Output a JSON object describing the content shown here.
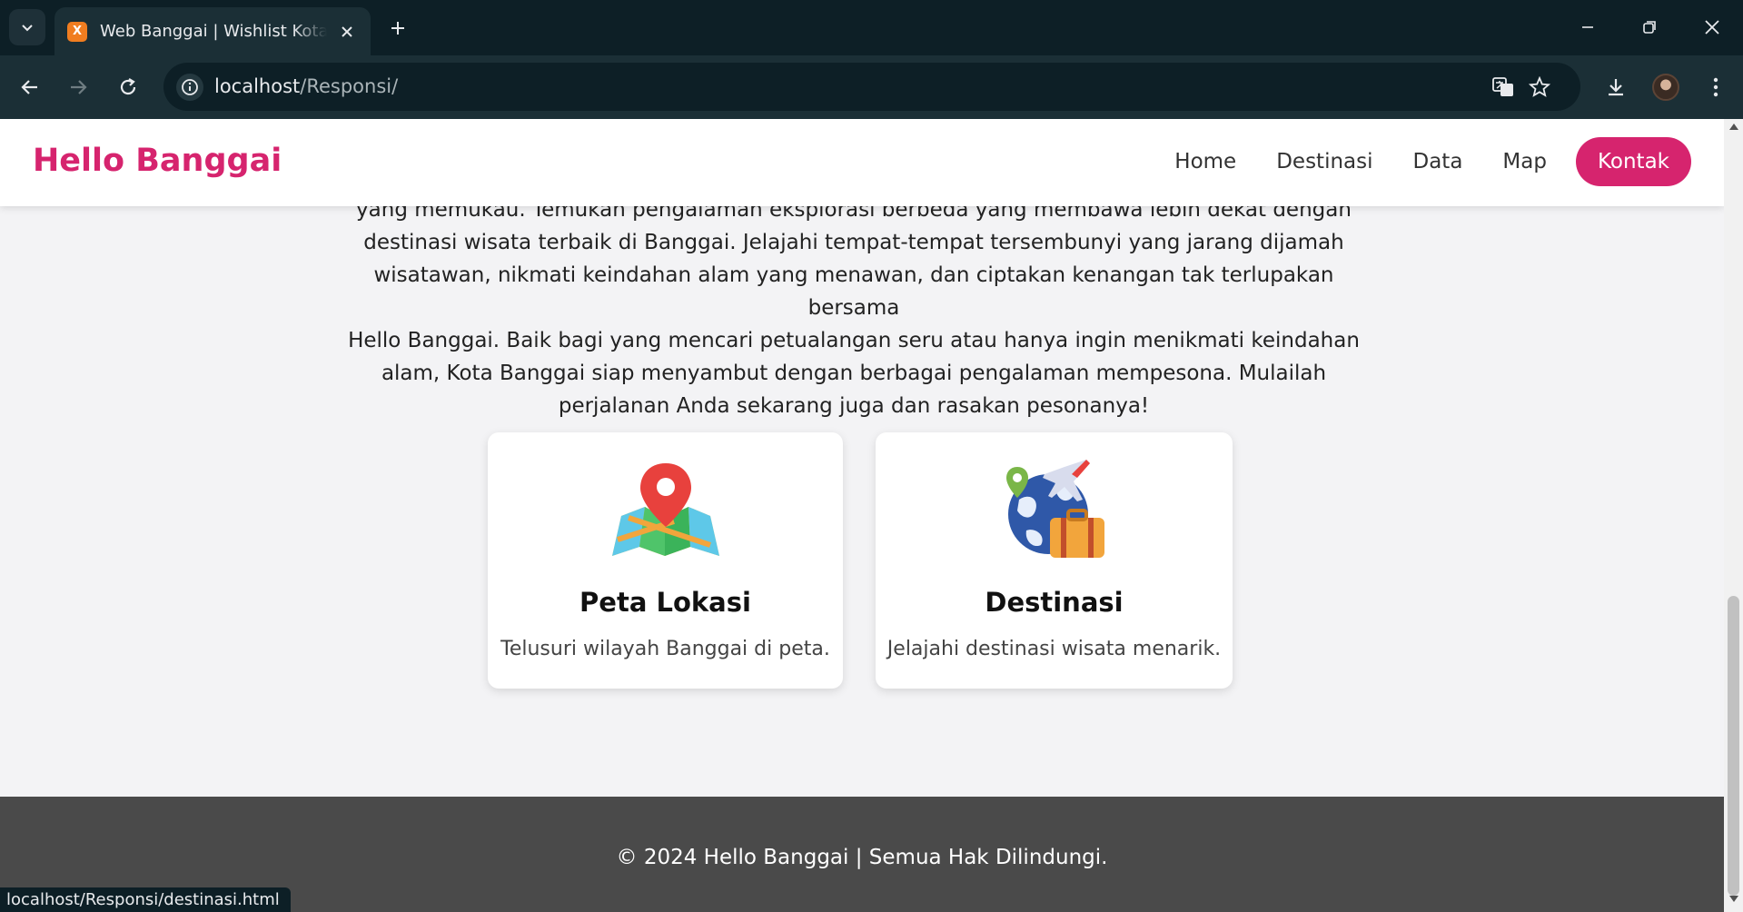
{
  "browser": {
    "tab_title": "Web Banggai | Wishlist Kota Am",
    "favicon_letter": "X",
    "url_host": "localhost",
    "url_path": "/Responsi/",
    "status_url": "localhost/Responsi/destinasi.html"
  },
  "site": {
    "brand": "Hello Banggai",
    "nav": [
      {
        "label": "Home"
      },
      {
        "label": "Destinasi"
      },
      {
        "label": "Data"
      },
      {
        "label": "Map"
      },
      {
        "label": "Kontak"
      }
    ],
    "intro_lines": [
      "yang memukau. Temukan pengalaman eksplorasi berbeda yang membawa lebih dekat dengan",
      "destinasi wisata terbaik di Banggai. Jelajahi tempat-tempat tersembunyi yang jarang dijamah",
      "wisatawan, nikmati keindahan alam yang menawan, dan ciptakan kenangan tak terlupakan bersama",
      "Hello Banggai. Baik bagi yang mencari petualangan seru atau hanya ingin menikmati keindahan",
      "alam, Kota Banggai siap menyambut dengan berbagai pengalaman mempesona. Mulailah",
      "perjalanan Anda sekarang juga dan rasakan pesonanya!"
    ],
    "cards": [
      {
        "title": "Peta Lokasi",
        "desc": "Telusuri wilayah Banggai di peta.",
        "icon": "map-pin-icon"
      },
      {
        "title": "Destinasi",
        "desc": "Jelajahi destinasi wisata menarik.",
        "icon": "travel-globe-icon"
      }
    ],
    "footer": "© 2024 Hello Banggai | Semua Hak Dilindungi."
  },
  "colors": {
    "brand": "#d6246e",
    "chrome_dark": "#0d1f26",
    "chrome_toolbar": "#1b2f36",
    "footer": "#4a4a4a"
  }
}
